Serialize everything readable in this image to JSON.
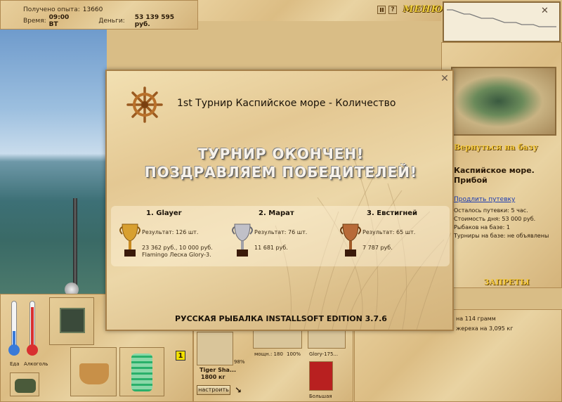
{
  "stats": {
    "experience_label": "Получено опыта:",
    "experience_value": "13660",
    "time_label": "Время:",
    "time_value": "09:00 ВТ",
    "money_label": "Деньги:",
    "money_value": "53 139 595 руб."
  },
  "topbar": {
    "help_label": "?",
    "menu_label": "МЕНЮ",
    "close_label": "✕"
  },
  "right_panel": {
    "back_to_base": "Вернуться на базу",
    "location_name_line1": "Каспийское море.",
    "location_name_line2": "Прибой",
    "extend_link": "Продлить путевку",
    "info": [
      "Осталось путевки: 5 час.",
      "Стоимость дня: 53 000 руб.",
      "Рыбаков на базе: 1",
      "Турниры на базе: не объявлены"
    ],
    "bans_label": "ЗАПРЕТЫ",
    "records": [
      "на 114 грамм",
      "жереха на 3,095 кг"
    ]
  },
  "bottom": {
    "food_label": "Еда",
    "alcohol_label": "Алкоголь",
    "slot_badge": "1",
    "tackle": {
      "rod_name": "Tiger Sha...",
      "rod_weight": "1800 кг",
      "line_percent": "98%",
      "reel_label": "мощн.: 180",
      "reel_percent": "100%",
      "line_name": "Glory-175...",
      "bait_label": "Большая",
      "setup_button": "настроить"
    }
  },
  "modal": {
    "title": "1st Турнир Каспийское море - Количество",
    "banner_line1": "ТУРНИР ОКОНЧЕН!",
    "banner_line2": "ПОЗДРАВЛЯЕМ ПОБЕДИТЕЛЕЙ!",
    "winners": [
      {
        "place_name": "1. Glayer",
        "result": "Результат: 126 шт.",
        "prize": "23 362 руб., 10 000 руб.",
        "prize_extra": "Flamingo Леска Glory-3.",
        "cup": "gold"
      },
      {
        "place_name": "2. Марат",
        "result": "Результат: 76 шт.",
        "prize": "11 681 руб.",
        "prize_extra": "",
        "cup": "silver"
      },
      {
        "place_name": "3. Евстигней",
        "result": "Результат: 65 шт.",
        "prize": "7 787 руб.",
        "prize_extra": "",
        "cup": "bronze"
      }
    ],
    "footer": "РУССКАЯ РЫБАЛКА INSTALLSOFT EDITION 3.7.6"
  },
  "colors": {
    "gold": "#d8a030",
    "silver": "#b8b8c0",
    "bronze": "#b86a38",
    "menu_yellow": "#f0d040",
    "banner_text": "#f7f2ea"
  },
  "depth_profile": [
    14,
    14,
    13,
    12,
    12,
    11,
    10,
    10,
    10,
    9,
    8,
    8,
    8,
    7,
    7,
    7,
    6,
    6,
    6,
    6
  ]
}
